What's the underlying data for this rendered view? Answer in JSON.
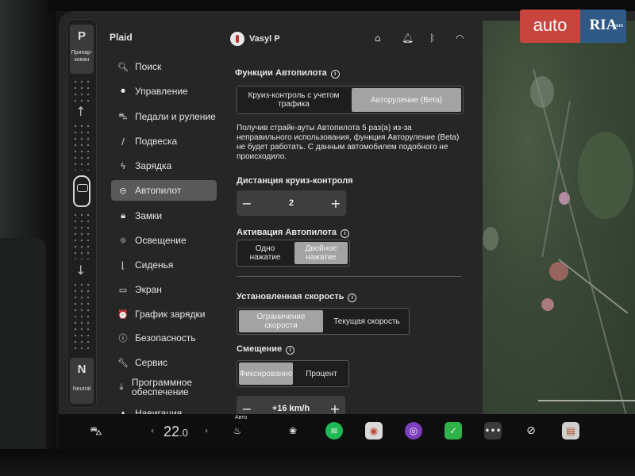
{
  "car": {
    "name": "Plaid"
  },
  "gear": {
    "park_letter": "P",
    "park_label": "Припар-кован",
    "neutral_letter": "N",
    "neutral_label": "Neutral"
  },
  "sidebar": {
    "items": [
      {
        "label": "Поиск",
        "icon": "search-icon",
        "glyph": "🔍︎"
      },
      {
        "label": "Управление",
        "icon": "toggle-icon",
        "glyph": "⏺"
      },
      {
        "label": "Педали и руление",
        "icon": "car-icon",
        "glyph": "⛍"
      },
      {
        "label": "Подвеска",
        "icon": "suspension-icon",
        "glyph": "∕"
      },
      {
        "label": "Зарядка",
        "icon": "bolt-icon",
        "glyph": "ϟ"
      },
      {
        "label": "Автопилот",
        "icon": "steering-wheel-icon",
        "glyph": "⊖",
        "active": true
      },
      {
        "label": "Замки",
        "icon": "lock-icon",
        "glyph": "🔒︎"
      },
      {
        "label": "Освещение",
        "icon": "sun-icon",
        "glyph": "☼"
      },
      {
        "label": "Сиденья",
        "icon": "seat-icon",
        "glyph": "⌊"
      },
      {
        "label": "Экран",
        "icon": "display-icon",
        "glyph": "▭"
      },
      {
        "label": "График зарядки",
        "icon": "alarm-clock-icon",
        "glyph": "⏰"
      },
      {
        "label": "Безопасность",
        "icon": "info-circle-icon",
        "glyph": "ⓘ"
      },
      {
        "label": "Сервис",
        "icon": "wrench-icon",
        "glyph": "🔧︎"
      },
      {
        "label": "Программное обеспечение",
        "icon": "download-icon",
        "glyph": "⤓"
      },
      {
        "label": "Навигация",
        "icon": "navigation-icon",
        "glyph": "▲"
      }
    ]
  },
  "status_bar": {
    "user_name": "Vasyl P",
    "icons": [
      "home-icon",
      "bell-icon",
      "bluetooth-icon",
      "wifi-icon"
    ]
  },
  "autopilot": {
    "features_title": "Функции Автопилота",
    "features_options": [
      "Круиз-контроль с учетом трафика",
      "Авторуление (Beta)"
    ],
    "features_selected": "Авторуление (Beta)",
    "warning": "Получив страйк-ауты Автопилота 5 раз(а) из-за неправильного использования, функция Авторуление (Beta) не будет работать. С данным автомобилем подобного не происходило.",
    "cruise_distance_title": "Дистанция круиз-контроля",
    "cruise_distance_value": "2",
    "activation_title": "Активация Автопилота",
    "activation_options": [
      "Одно нажатие",
      "Двойное нажатие"
    ],
    "activation_selected": "Двойное нажатие",
    "set_speed_title": "Установленная скорость",
    "set_speed_options": [
      "Ограничение скорости",
      "Текущая скорость"
    ],
    "set_speed_selected": "Ограничение скорости",
    "offset_title": "Смещение",
    "offset_options": [
      "Фиксированно",
      "Процент"
    ],
    "offset_selected": "Фиксированно",
    "offset_value": "+16 km/h",
    "minus_label": "−",
    "plus_label": "+"
  },
  "taskbar": {
    "temperature_main": "22",
    "temperature_decimal": ".0",
    "seat_heat_label": "Авто",
    "icons": [
      "car-icon",
      "seat-heater-icon",
      "fan-icon",
      "spotify-icon",
      "camera-icon",
      "media-icon",
      "calendar-icon",
      "more-icon",
      "disconnected-icon",
      "card-icon"
    ]
  },
  "watermark": {
    "brand_left": "auto",
    "brand_right": "RIA",
    "domain": ".com"
  },
  "colors": {
    "screen_bg": "#262626",
    "active_item": "#595959",
    "segment_active": "#a3a3a3",
    "spotify": "#1db954",
    "watermark_red": "#c8453e",
    "watermark_blue": "#2f5a86"
  }
}
